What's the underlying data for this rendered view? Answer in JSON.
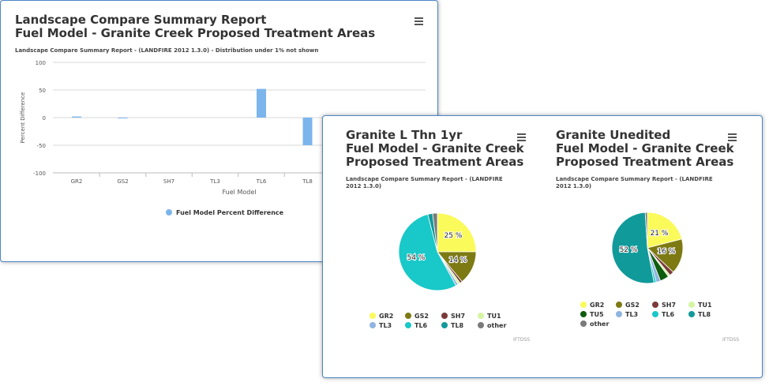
{
  "bar_panel": {
    "title_line1": "Landscape Compare Summary Report",
    "title_line2": "Fuel Model - Granite Creek Proposed Treatment Areas",
    "subtitle": "Landscape Compare Summary Report - (LANDFIRE 2012 1.3.0) - Distribution under 1% not shown",
    "menu_icon": "hamburger-menu-icon"
  },
  "pie1": {
    "title_line1": "Granite L Thn 1yr",
    "title_line2": "Fuel Model - Granite Creek",
    "title_line3": "Proposed Treatment Areas",
    "subtitle_line1": "Landscape Compare Summary Report - (LANDFIRE",
    "subtitle_line2": "2012 1.3.0)",
    "credit": "IFTDSS",
    "menu_icon": "hamburger-menu-icon"
  },
  "pie2": {
    "title_line1": "Granite Unedited",
    "title_line2": "Fuel Model - Granite Creek",
    "title_line3": "Proposed Treatment Areas",
    "subtitle_line1": "Landscape Compare Summary Report - (LANDFIRE",
    "subtitle_line2": "2012 1.3.0)",
    "credit": "IFTDSS",
    "menu_icon": "hamburger-menu-icon"
  },
  "colors": {
    "GR2": "#fafa5a",
    "GS2": "#7d7a14",
    "SH7": "#7a3a3a",
    "TU1": "#d4f5a0",
    "TU5": "#0e5c0e",
    "TL3": "#8fb4e0",
    "TL6": "#19c8c8",
    "TL8": "#119a9a",
    "other": "#7a7a7a",
    "bar": "#7cb5ec"
  },
  "chart_data": [
    {
      "type": "bar",
      "title": "Landscape Compare Summary Report\nFuel Model - Granite Creek Proposed Treatment Areas",
      "subtitle": "Landscape Compare Summary Report - (LANDFIRE 2012 1.3.0) - Distribution under 1% not shown",
      "categories": [
        "GR2",
        "GS2",
        "SH7",
        "TL3",
        "TL6",
        "TL8"
      ],
      "series": [
        {
          "name": "Fuel Model Percent Difference",
          "values": [
            2,
            -1,
            0,
            0,
            52,
            -50
          ]
        }
      ],
      "xlabel": "Fuel Model",
      "ylabel": "Percent Difference",
      "ylim": [
        -100,
        100
      ],
      "yticks": [
        100,
        50,
        0,
        -50,
        -100
      ],
      "grid": true,
      "legend": "bottom"
    },
    {
      "type": "pie",
      "title": "Granite L Thn 1yr\nFuel Model - Granite Creek\nProposed Treatment Areas",
      "labels": [
        "GR2",
        "GS2",
        "SH7",
        "TU1",
        "TL3",
        "TL6",
        "TL8",
        "other"
      ],
      "values": [
        25,
        14,
        1,
        1,
        1,
        54,
        2,
        2
      ],
      "data_labels": [
        "25 %",
        "14 %",
        "54 %"
      ],
      "legend": "bottom"
    },
    {
      "type": "pie",
      "title": "Granite Unedited\nFuel Model - Granite Creek\nProposed Treatment Areas",
      "labels": [
        "GR2",
        "GS2",
        "SH7",
        "TU1",
        "TU5",
        "TL3",
        "TL6",
        "TL8",
        "other"
      ],
      "values": [
        21,
        16,
        2,
        1,
        4,
        2,
        1,
        52,
        1
      ],
      "data_labels": [
        "21 %",
        "16 %",
        "52 %"
      ],
      "legend": "bottom"
    }
  ]
}
